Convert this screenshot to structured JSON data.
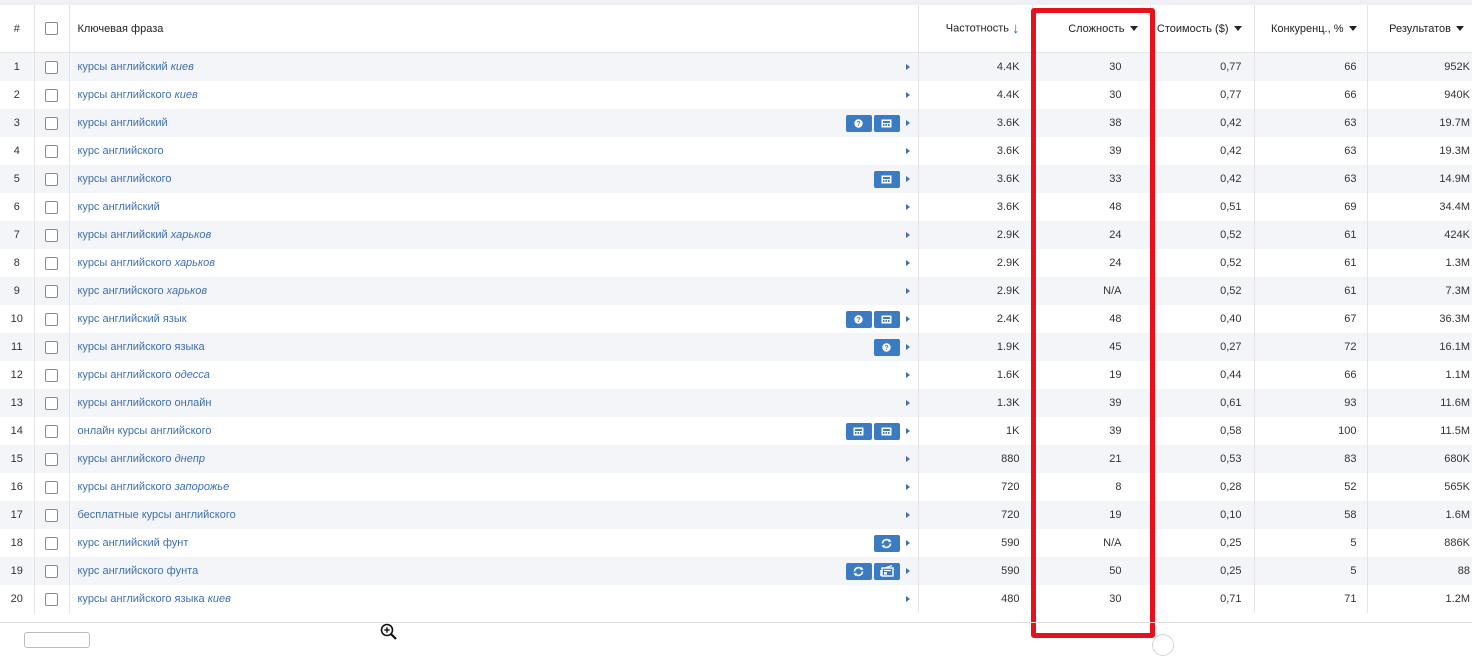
{
  "headers": {
    "num": "#",
    "keyword": "Ключевая фраза",
    "frequency": "Частотность",
    "difficulty": "Сложность",
    "cost": "Стоимость ($)",
    "competition": "Конкуренц., %",
    "results": "Результатов"
  },
  "colors": {
    "accent": "#3a7bc4",
    "link": "#3d6fb1",
    "highlight": "#e8101a"
  },
  "rows": [
    {
      "n": "1",
      "base": "курсы английский ",
      "geo": "киев",
      "icons": [],
      "freq": "4.4K",
      "diff": "30",
      "cost": "0,77",
      "comp": "66",
      "res": "952K"
    },
    {
      "n": "2",
      "base": "курсы английского ",
      "geo": "киев",
      "icons": [],
      "freq": "4.4K",
      "diff": "30",
      "cost": "0,77",
      "comp": "66",
      "res": "940K"
    },
    {
      "n": "3",
      "base": "курсы английский",
      "geo": "",
      "icons": [
        "question-icon",
        "image-icon"
      ],
      "freq": "3.6K",
      "diff": "38",
      "cost": "0,42",
      "comp": "63",
      "res": "19.7M"
    },
    {
      "n": "4",
      "base": "курс английского",
      "geo": "",
      "icons": [],
      "freq": "3.6K",
      "diff": "39",
      "cost": "0,42",
      "comp": "63",
      "res": "19.3M"
    },
    {
      "n": "5",
      "base": "курсы английского",
      "geo": "",
      "icons": [
        "image-icon"
      ],
      "freq": "3.6K",
      "diff": "33",
      "cost": "0,42",
      "comp": "63",
      "res": "14.9M"
    },
    {
      "n": "6",
      "base": "курс английский",
      "geo": "",
      "icons": [],
      "freq": "3.6K",
      "diff": "48",
      "cost": "0,51",
      "comp": "69",
      "res": "34.4M"
    },
    {
      "n": "7",
      "base": "курсы английский ",
      "geo": "харьков",
      "icons": [],
      "freq": "2.9K",
      "diff": "24",
      "cost": "0,52",
      "comp": "61",
      "res": "424K"
    },
    {
      "n": "8",
      "base": "курсы английского ",
      "geo": "харьков",
      "icons": [],
      "freq": "2.9K",
      "diff": "24",
      "cost": "0,52",
      "comp": "61",
      "res": "1.3M"
    },
    {
      "n": "9",
      "base": "курс английского ",
      "geo": "харьков",
      "icons": [],
      "freq": "2.9K",
      "diff": "N/A",
      "cost": "0,52",
      "comp": "61",
      "res": "7.3M"
    },
    {
      "n": "10",
      "base": "курс английский язык",
      "geo": "",
      "icons": [
        "question-icon",
        "image-icon"
      ],
      "freq": "2.4K",
      "diff": "48",
      "cost": "0,40",
      "comp": "67",
      "res": "36.3M"
    },
    {
      "n": "11",
      "base": "курсы английского языка",
      "geo": "",
      "icons": [
        "question-icon"
      ],
      "freq": "1.9K",
      "diff": "45",
      "cost": "0,27",
      "comp": "72",
      "res": "16.1M"
    },
    {
      "n": "12",
      "base": "курсы английского ",
      "geo": "одесса",
      "icons": [],
      "freq": "1.6K",
      "diff": "19",
      "cost": "0,44",
      "comp": "66",
      "res": "1.1M"
    },
    {
      "n": "13",
      "base": "курсы английского онлайн",
      "geo": "",
      "icons": [],
      "freq": "1.3K",
      "diff": "39",
      "cost": "0,61",
      "comp": "93",
      "res": "11.6M"
    },
    {
      "n": "14",
      "base": "онлайн курсы английского",
      "geo": "",
      "icons": [
        "image-icon",
        "image-icon"
      ],
      "freq": "1K",
      "diff": "39",
      "cost": "0,58",
      "comp": "100",
      "res": "11.5M"
    },
    {
      "n": "15",
      "base": "курсы английского ",
      "geo": "днепр",
      "icons": [],
      "freq": "880",
      "diff": "21",
      "cost": "0,53",
      "comp": "83",
      "res": "680K"
    },
    {
      "n": "16",
      "base": "курсы английского ",
      "geo": "запорожье",
      "icons": [],
      "freq": "720",
      "diff": "8",
      "cost": "0,28",
      "comp": "52",
      "res": "565K"
    },
    {
      "n": "17",
      "base": "бесплатные курсы английского",
      "geo": "",
      "icons": [],
      "freq": "720",
      "diff": "19",
      "cost": "0,10",
      "comp": "58",
      "res": "1.6M"
    },
    {
      "n": "18",
      "base": "курс английский фунт",
      "geo": "",
      "icons": [
        "refresh-icon"
      ],
      "freq": "590",
      "diff": "N/A",
      "cost": "0,25",
      "comp": "5",
      "res": "886K"
    },
    {
      "n": "19",
      "base": "курс английского фунта",
      "geo": "",
      "icons": [
        "refresh-icon",
        "newspaper-icon"
      ],
      "freq": "590",
      "diff": "50",
      "cost": "0,25",
      "comp": "5",
      "res": "88"
    },
    {
      "n": "20",
      "base": "курсы английского языка ",
      "geo": "киев",
      "icons": [],
      "freq": "480",
      "diff": "30",
      "cost": "0,71",
      "comp": "71",
      "res": "1.2M"
    }
  ]
}
